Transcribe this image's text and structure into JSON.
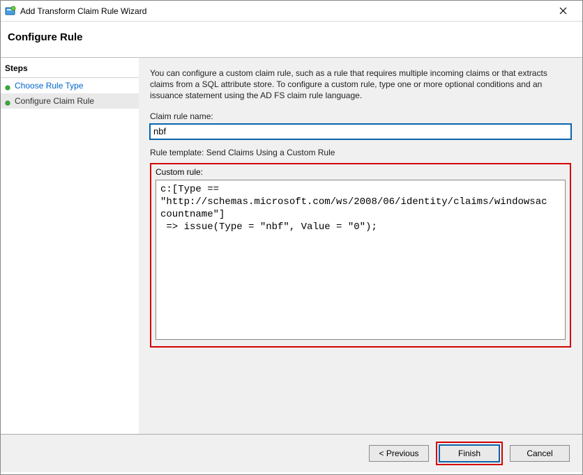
{
  "window": {
    "title": "Add Transform Claim Rule Wizard"
  },
  "header": {
    "title": "Configure Rule"
  },
  "steps": {
    "header": "Steps",
    "items": [
      {
        "label": "Choose Rule Type"
      },
      {
        "label": "Configure Claim Rule"
      }
    ]
  },
  "content": {
    "description": "You can configure a custom claim rule, such as a rule that requires multiple incoming claims or that extracts claims from a SQL attribute store. To configure a custom rule, type one or more optional conditions and an issuance statement using the AD FS claim rule language.",
    "name_label": "Claim rule name:",
    "name_value": "nbf",
    "template_label": "Rule template: Send Claims Using a Custom Rule",
    "custom_label": "Custom rule:",
    "custom_value": "c:[Type == \"http://schemas.microsoft.com/ws/2008/06/identity/claims/windowsaccountname\"]\n => issue(Type = \"nbf\", Value = \"0\");"
  },
  "buttons": {
    "previous": "< Previous",
    "finish": "Finish",
    "cancel": "Cancel"
  }
}
